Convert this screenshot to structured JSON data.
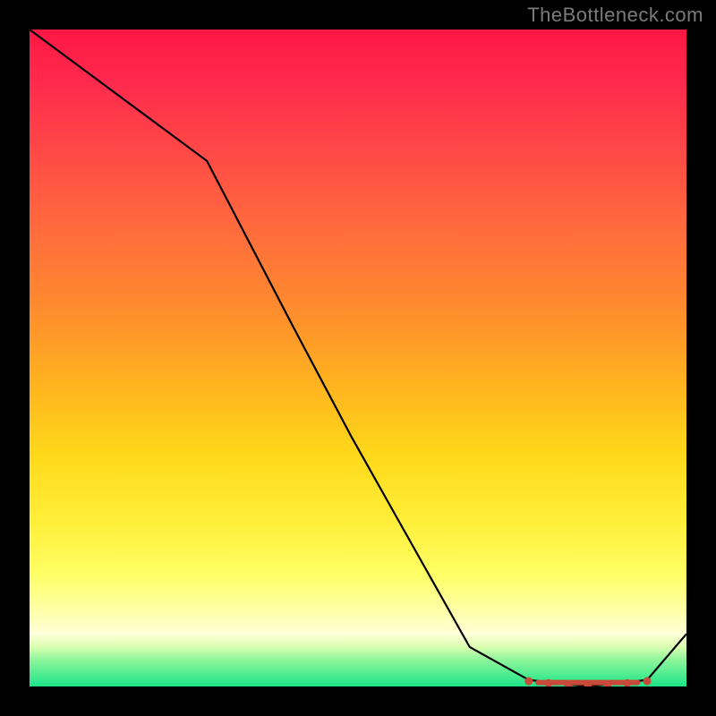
{
  "attribution": "TheBottleneck.com",
  "chart_data": {
    "type": "line",
    "title": "",
    "xlabel": "",
    "ylabel": "",
    "x": [
      0,
      27,
      40,
      49,
      58,
      67,
      76,
      85,
      94,
      100
    ],
    "y": [
      100,
      80,
      55,
      38,
      22,
      6,
      1,
      0,
      1,
      8
    ],
    "ylim": [
      0,
      100
    ],
    "xlim": [
      0,
      100
    ],
    "markers": {
      "x": [
        76,
        79,
        82,
        85,
        88,
        91,
        94
      ],
      "y": [
        0.8,
        0.5,
        0.3,
        0.2,
        0.3,
        0.5,
        0.8
      ]
    },
    "marker_bar": {
      "x_start": 77,
      "x_end": 93,
      "y": 0.6,
      "height": 0.8
    }
  }
}
